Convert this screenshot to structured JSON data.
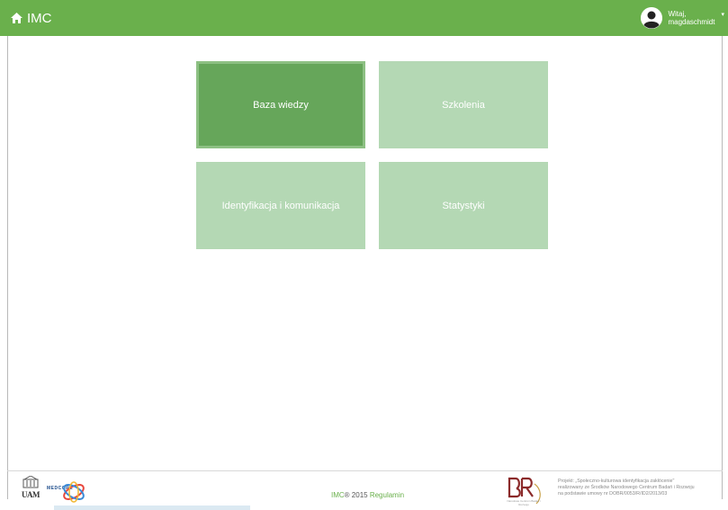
{
  "navbar": {
    "brand": "IMC",
    "greeting": "Witaj,",
    "username": "magdaschmidt",
    "caret": "▾"
  },
  "tiles": [
    {
      "label": "Baza wiedzy",
      "active": true
    },
    {
      "label": "Szkolenia",
      "active": false
    },
    {
      "label": "Identyfikacja i komunikacja",
      "active": false
    },
    {
      "label": "Statystyki",
      "active": false
    }
  ],
  "footer": {
    "uam_logo": "UAM",
    "medcore_logo": "MEDCORE",
    "copyright_brand": "IMC",
    "copyright_year": "® 2015",
    "terms_link": "Regulamin",
    "br_logo_caption": "Narodowe Centrum Badań i Rozwoju",
    "project_line1": "Projekt: „Społeczno-kulturowa identyfikacja zakłócenie\"",
    "project_line2": "realizowany ze Środków Narodowego Centrum Badań i Rozwoju",
    "project_line3": "na podstawie umowy nr DOBR/0053/R/ID2/2013/03"
  },
  "colors": {
    "navbar": "#6ab04c",
    "tile": "#b4d8b4",
    "tile_active": "#66a65a"
  }
}
